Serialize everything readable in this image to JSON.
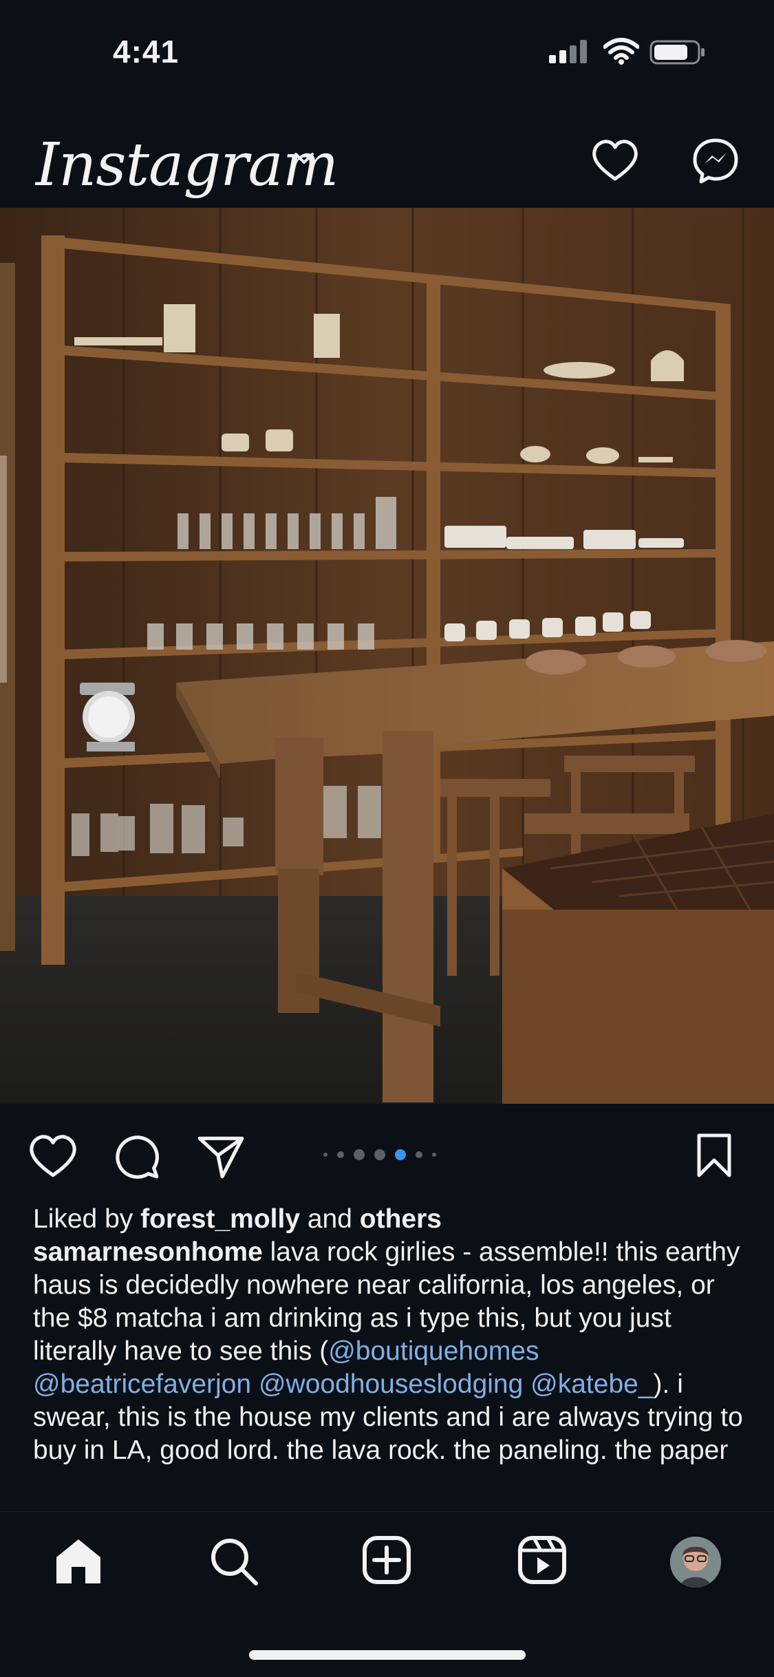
{
  "status_bar": {
    "time": "4:41",
    "battery_level": 0.8
  },
  "header": {
    "logo": "Instagram",
    "icons": [
      "chevron-down-icon",
      "heart-icon",
      "messenger-icon"
    ]
  },
  "post": {
    "carousel": {
      "total": 7,
      "active_index": 4
    },
    "liked_by": {
      "prefix": "Liked by ",
      "user": "forest_molly",
      "middle": " and ",
      "others": "others"
    },
    "caption": {
      "username": "samarnesonhome",
      "text_1": " lava rock girlies - assemble!! this earthy haus is decidedly nowhere near california, los angeles, or the $8 matcha i am drinking as i type this, but you just literally have to see this (",
      "mentions": [
        "@boutiquehomes",
        "@beatricefaverjon",
        "@woodhouseslodging",
        "@katebe_"
      ],
      "text_2": "). i swear, this is the house my clients and i are always trying to buy in LA, good lord. the lava rock. the paneling. the paper"
    }
  },
  "tabbar": {
    "tabs": [
      "home-icon",
      "search-icon",
      "new-post-icon",
      "reels-icon",
      "profile-avatar"
    ]
  },
  "colors": {
    "background": "#0b0f16",
    "accent": "#3897f0",
    "mention": "#7fb0e6"
  }
}
